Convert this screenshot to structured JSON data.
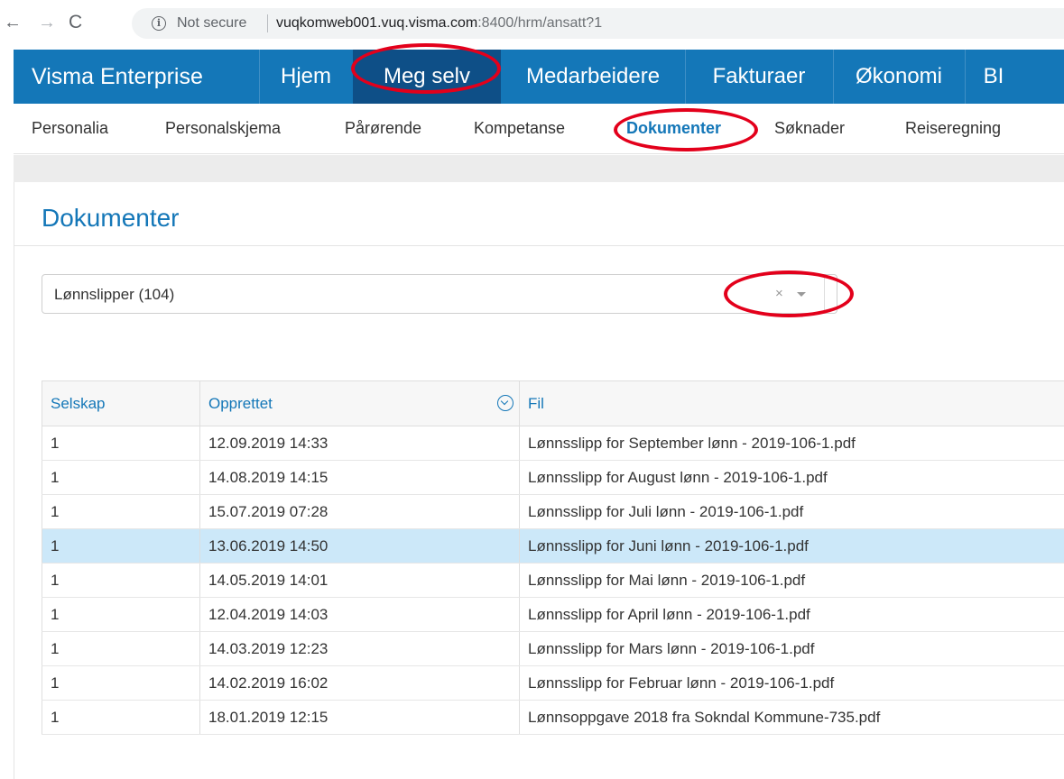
{
  "browser": {
    "back_icon": "←",
    "forward_icon": "→",
    "reload_icon": "C",
    "info_icon": "i",
    "security_label": "Not secure",
    "url_host": "vuqkomweb001.vuq.visma.com",
    "url_rest": ":8400/hrm/ansatt?1"
  },
  "topnav": {
    "brand": "Visma Enterprise",
    "items": [
      {
        "label": "Hjem"
      },
      {
        "label": "Meg selv"
      },
      {
        "label": "Medarbeidere"
      },
      {
        "label": "Fakturaer"
      },
      {
        "label": "Økonomi"
      },
      {
        "label": "BI"
      }
    ]
  },
  "subnav": {
    "items": [
      {
        "label": "Personalia"
      },
      {
        "label": "Personalskjema"
      },
      {
        "label": "Pårørende"
      },
      {
        "label": "Kompetanse"
      },
      {
        "label": "Dokumenter"
      },
      {
        "label": "Søknader"
      },
      {
        "label": "Reiseregning"
      }
    ]
  },
  "page": {
    "title": "Dokumenter",
    "filter": {
      "value": "Lønnslipper (104)",
      "clear_icon": "×"
    }
  },
  "table": {
    "columns": [
      "Selskap",
      "Opprettet",
      "Fil"
    ],
    "rows": [
      {
        "selskap": "1",
        "opprettet": "12.09.2019 14:33",
        "fil": "Lønnsslipp for September lønn - 2019-106-1.pdf"
      },
      {
        "selskap": "1",
        "opprettet": "14.08.2019 14:15",
        "fil": "Lønnsslipp for August lønn - 2019-106-1.pdf"
      },
      {
        "selskap": "1",
        "opprettet": "15.07.2019 07:28",
        "fil": "Lønnsslipp for Juli lønn - 2019-106-1.pdf"
      },
      {
        "selskap": "1",
        "opprettet": "13.06.2019 14:50",
        "fil": "Lønnsslipp for Juni lønn - 2019-106-1.pdf"
      },
      {
        "selskap": "1",
        "opprettet": "14.05.2019 14:01",
        "fil": "Lønnsslipp for Mai lønn - 2019-106-1.pdf"
      },
      {
        "selskap": "1",
        "opprettet": "12.04.2019 14:03",
        "fil": "Lønnsslipp for April lønn - 2019-106-1.pdf"
      },
      {
        "selskap": "1",
        "opprettet": "14.03.2019 12:23",
        "fil": "Lønnsslipp for Mars lønn - 2019-106-1.pdf"
      },
      {
        "selskap": "1",
        "opprettet": "14.02.2019 16:02",
        "fil": "Lønnsslipp for Februar lønn - 2019-106-1.pdf"
      },
      {
        "selskap": "1",
        "opprettet": "18.01.2019 12:15",
        "fil": "Lønnsoppgave 2018 fra Sokndal Kommune-735.pdf"
      }
    ]
  },
  "colors": {
    "brand_blue": "#1477b8",
    "active_nav": "#0e4f87",
    "selected_row": "#cce8f9",
    "annotation_red": "#e3001b"
  }
}
